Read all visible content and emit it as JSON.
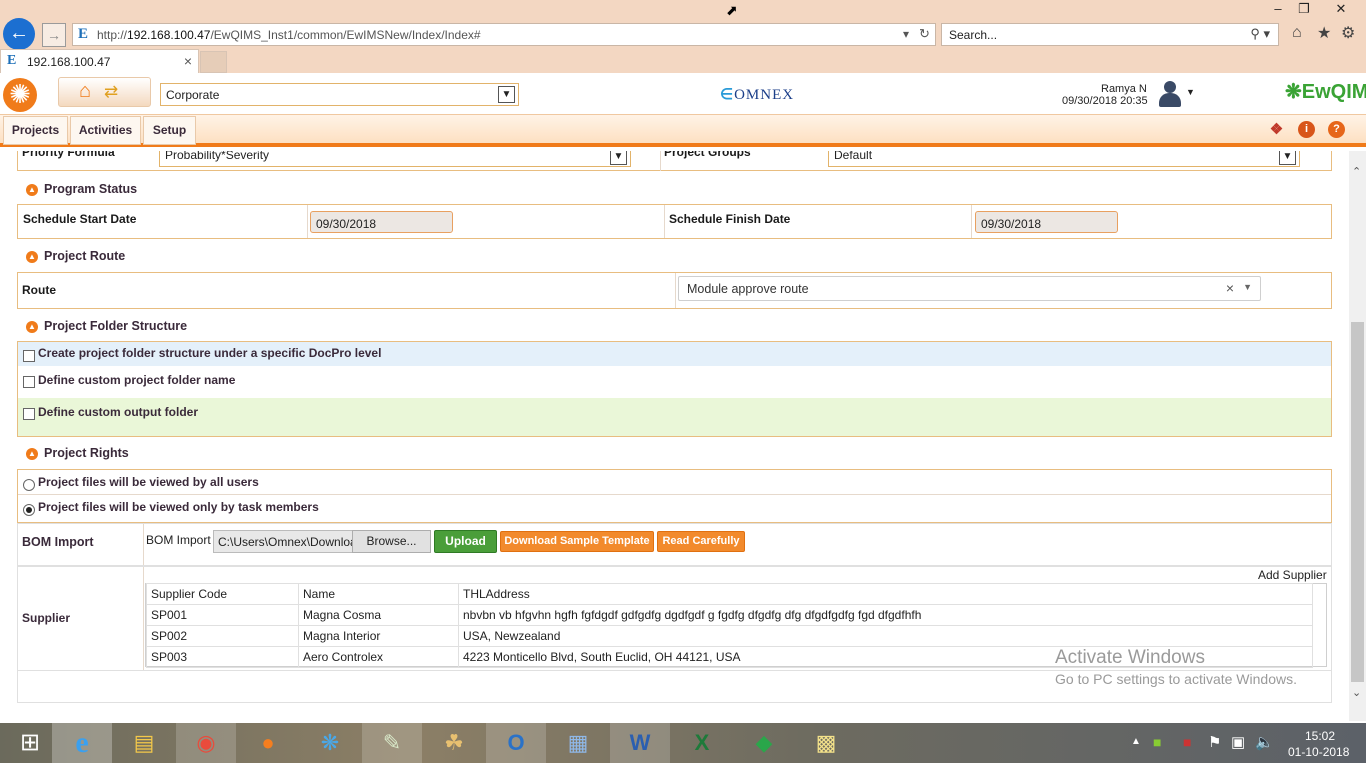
{
  "browser": {
    "url_prefix": "http://",
    "url_host": "192.168.100.47",
    "url_path": "/EwQIMS_Inst1/common/EwIMSNew/Index/Index#",
    "search_placeholder": "Search...",
    "tab_title": "192.168.100.47"
  },
  "header": {
    "org_select": "Corporate",
    "brand": "OMNEX",
    "user_name": "Ramya N",
    "user_datetime": "09/30/2018 20:35",
    "app_logo": "EwQIMS",
    "app_logo_sup": "IMS"
  },
  "menu": {
    "projects": "Projects",
    "activities": "Activities",
    "setup": "Setup"
  },
  "form": {
    "priority_formula_label": "Priority Formula",
    "priority_formula_value": "Probability*Severity",
    "project_groups_label": "Project Groups",
    "project_groups_value": "Default",
    "program_status": {
      "title": "Program Status",
      "start_label": "Schedule Start Date",
      "start_value": "09/30/2018",
      "finish_label": "Schedule Finish Date",
      "finish_value": "09/30/2018"
    },
    "project_route": {
      "title": "Project Route",
      "route_label": "Route",
      "route_value": "Module approve route"
    },
    "folder_structure": {
      "title": "Project Folder Structure",
      "opt1": "Create project folder structure under a specific DocPro level",
      "opt2": "Define custom project folder name",
      "opt3": "Define custom output folder"
    },
    "project_rights": {
      "title": "Project Rights",
      "opt1": "Project files will be viewed by all users",
      "opt2": "Project files will be viewed only by task members"
    },
    "bom": {
      "section_label": "BOM Import",
      "field_label": "BOM Import",
      "file_value": "C:\\Users\\Omnex\\Downloa",
      "browse": "Browse...",
      "upload": "Upload",
      "download_template": "Download Sample Template",
      "read_carefully": "Read Carefully"
    },
    "supplier": {
      "section_label": "Supplier",
      "add_link": "Add Supplier",
      "headers": [
        "Supplier Code",
        "Name",
        "THLAddress"
      ],
      "rows": [
        [
          "SP001",
          "Magna Cosma",
          "nbvbn vb hfgvhn hgfh fgfdgdf gdfgdfg dgdfgdf g fgdfg dfgdfg dfg dfgdfgdfg fgd dfgdfhfh"
        ],
        [
          "SP002",
          "Magna Interior",
          "USA, Newzealand"
        ],
        [
          "SP003",
          "Aero Controlex",
          "4223 Monticello Blvd, South Euclid, OH 44121, USA"
        ]
      ]
    }
  },
  "watermark": {
    "line1": "Activate Windows",
    "line2": "Go to PC settings to activate Windows."
  },
  "taskbar": {
    "time": "15:02",
    "date": "01-10-2018"
  },
  "colors": {
    "accent": "#f07b1a",
    "frame_border": "#e8bd80",
    "upload_green": "#4a9e3a",
    "highlight_blue": "#e4f0fa",
    "highlight_green": "#eaf7d8"
  }
}
